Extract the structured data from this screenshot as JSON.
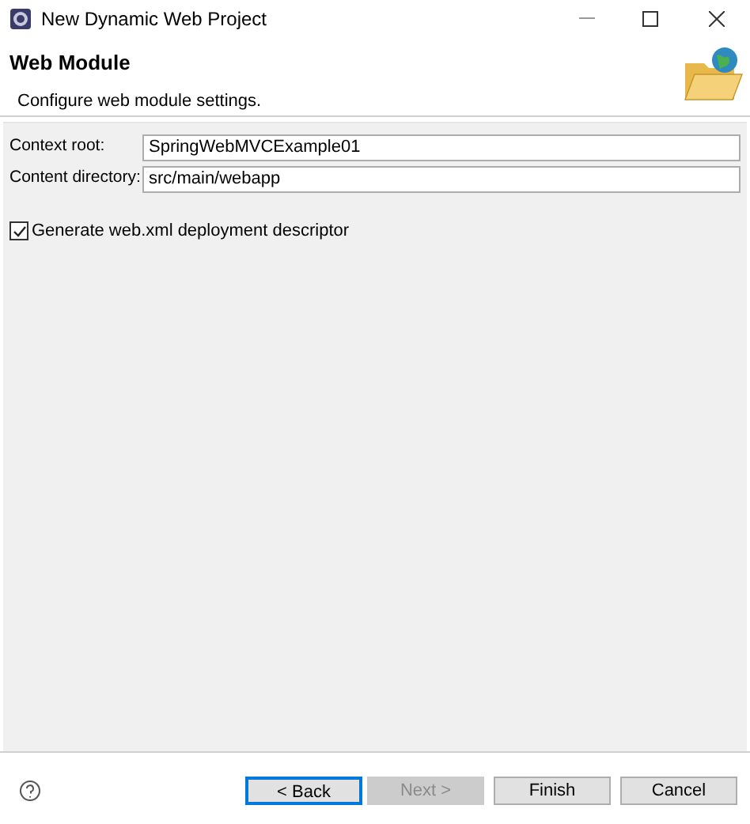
{
  "window": {
    "title": "New Dynamic Web Project"
  },
  "header": {
    "title": "Web Module",
    "description": "Configure web module settings."
  },
  "fields": [
    {
      "label": "Context root:",
      "value": "SpringWebMVCExample01"
    },
    {
      "label": "Content directory:",
      "value": "src/main/webapp"
    }
  ],
  "checkbox": {
    "label": "Generate web.xml deployment descriptor",
    "checked": true
  },
  "buttons": [
    {
      "label": "< Back",
      "disabled": false,
      "focused": true
    },
    {
      "label": "Next >",
      "disabled": true,
      "focused": false
    },
    {
      "label": "Finish",
      "disabled": false,
      "focused": false
    },
    {
      "label": "Cancel",
      "disabled": false,
      "focused": false
    }
  ]
}
